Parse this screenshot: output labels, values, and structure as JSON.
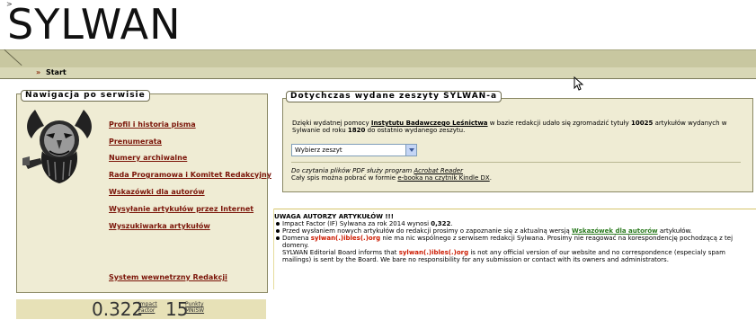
{
  "site": {
    "logo": "SYLWAN",
    "caret": ">"
  },
  "breadcrumb": {
    "arrow": "»",
    "label": "Start"
  },
  "nav": {
    "legend": "Nawigacja po serwisie",
    "links": [
      "Profil i historia pisma",
      "Prenumerata",
      "Numery archiwalne",
      "Rada Programowa i Komitet Redakcyjny",
      "Wskazówki dla autorów",
      "Wysyłanie artykułów przez Internet",
      "Wyszukiwarka artykułów"
    ],
    "system_link": "System wewnetrzny Redakcji"
  },
  "issues": {
    "legend": "Dotychczas wydane zeszyty SYLWAN-a",
    "intro_1": "Dzięki wydatnej pomocy ",
    "intro_institute": "Instytutu Badawczego Leśnictwa",
    "intro_2": " w bazie redakcji udało się zgromadzić tytuły ",
    "intro_count": "10025",
    "intro_3": " artykułów wydanych w Sylwanie od roku ",
    "intro_year": "1820",
    "intro_4": " do ostatnio wydanego zeszytu.",
    "select_value": "Wybierz zeszyt",
    "pdf_note_1": "Do czytania plików PDF służy program ",
    "pdf_note_link": "Acrobat Reader",
    "kindle_1": "Cały spis można pobrać w formie ",
    "kindle_link": "e-booka na czytnik Kindle DX",
    "kindle_2": "."
  },
  "warning": {
    "title": "UWAGA AUTORZY ARTYKUŁÓW !!!",
    "if_1": "Impact Factor (IF) Sylwana za rok 2014 wynosi ",
    "if_value": "0,322",
    "if_2": ".",
    "guide_1": "Przed wysłaniem nowych artykułów do redakcji prosimy o zapoznanie się z aktualną wersją ",
    "guide_link": "Wskazówek dla autorów",
    "guide_2": " artykułów.",
    "domain_1": "Domena ",
    "domain_red": "sylwan(.)ibles(.)org",
    "domain_2": " nie ma nic wspólnego z serwisem redakcji Sylwana. Prosimy nie reagować na korespondencję pochodzącą z tej domeny.",
    "en_1": "SYLWAN Editorial Board informs that ",
    "en_red": "sylwan(.)ibles(.)org",
    "en_2": " is not any official version of our website and no correspondence (especialy spam mailings) is sent by the Board. We bare no responsibility for any submission or contact with its owners and administrators."
  },
  "metrics": {
    "impact_value": "0.322",
    "impact_label_1": "Impact",
    "impact_label_2": "Factor",
    "points_value": "15",
    "points_label_1": "Punkty",
    "points_label_2": "MNiSW"
  },
  "colors": {
    "nav_link": "#7a1408",
    "warning_red": "#cc1a00",
    "guide_green": "#2a7a1e",
    "panel_bg": "#efecd4"
  }
}
